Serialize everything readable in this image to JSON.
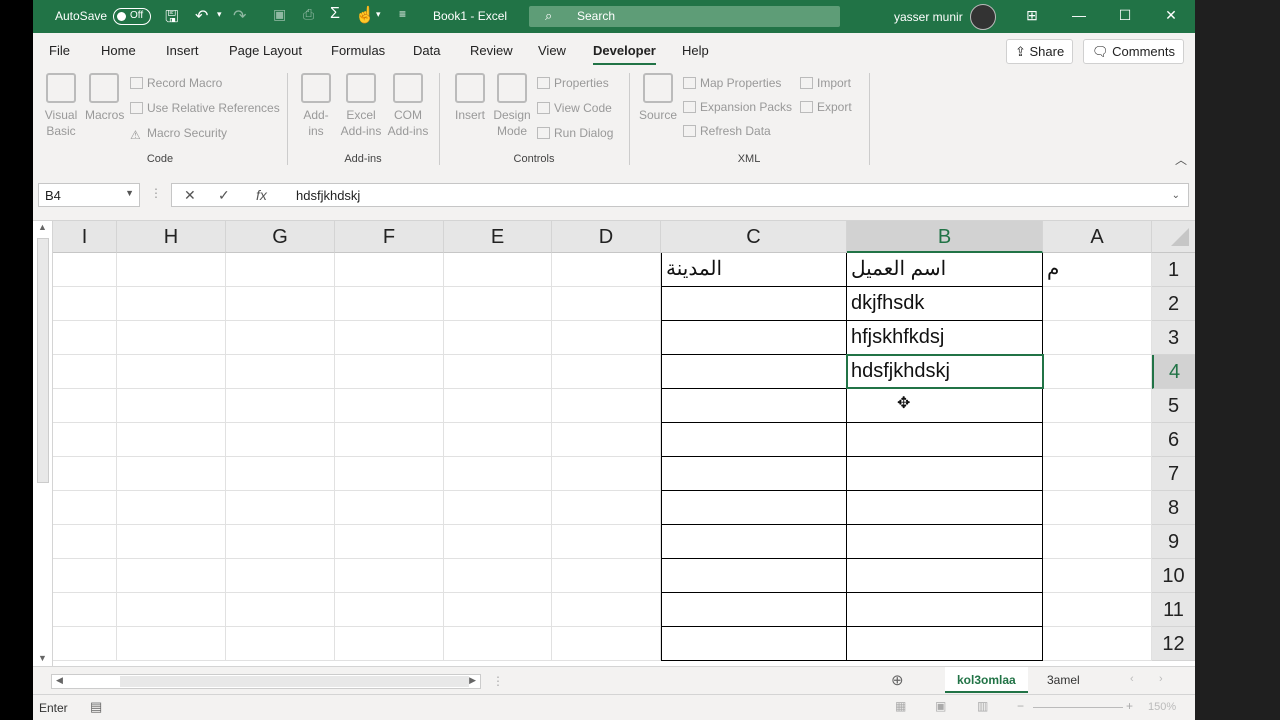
{
  "titlebar": {
    "autosave_label": "AutoSave",
    "autosave_state": "Off",
    "doc_title": "Book1 - Excel",
    "search_placeholder": "Search",
    "user_name": "yasser munir"
  },
  "tabs": [
    "File",
    "Home",
    "Insert",
    "Page Layout",
    "Formulas",
    "Data",
    "Review",
    "View",
    "Developer",
    "Help"
  ],
  "active_tab": "Developer",
  "share_label": "Share",
  "comments_label": "Comments",
  "ribbon": {
    "code": {
      "label": "Code",
      "visual_basic": "Visual Basic",
      "macros": "Macros",
      "record_macro": "Record Macro",
      "relative_refs": "Use Relative References",
      "macro_security": "Macro Security"
    },
    "addins": {
      "label": "Add-ins",
      "addins": "Add-ins",
      "excel_addins": "Excel Add-ins",
      "com_addins": "COM Add-ins"
    },
    "controls": {
      "label": "Controls",
      "insert": "Insert",
      "design_mode": "Design Mode",
      "properties": "Properties",
      "view_code": "View Code",
      "run_dialog": "Run Dialog"
    },
    "xml": {
      "label": "XML",
      "source": "Source",
      "map_properties": "Map Properties",
      "expansion_packs": "Expansion Packs",
      "refresh_data": "Refresh Data",
      "import": "Import",
      "export": "Export"
    }
  },
  "formula_bar": {
    "name_box": "B4",
    "value": "hdsfjkhdskj"
  },
  "columns": [
    "I",
    "H",
    "G",
    "F",
    "E",
    "D",
    "C",
    "B",
    "A"
  ],
  "rows": [
    "1",
    "2",
    "3",
    "4",
    "5",
    "6",
    "7",
    "8",
    "9",
    "10",
    "11",
    "12"
  ],
  "cells": {
    "A1": "م",
    "B1": "اسم العميل",
    "C1": "المدينة",
    "B2": "dkjfhsdk",
    "B3": "hfjskhfkdsj",
    "B4": "hdsfjkhdskj"
  },
  "active_cell": "B4",
  "sheet_tabs": [
    "kol3omlaa",
    "3amel"
  ],
  "active_sheet": "kol3omlaa",
  "status": {
    "mode": "Enter",
    "zoom": "150%"
  },
  "colors": {
    "accent": "#217346"
  }
}
